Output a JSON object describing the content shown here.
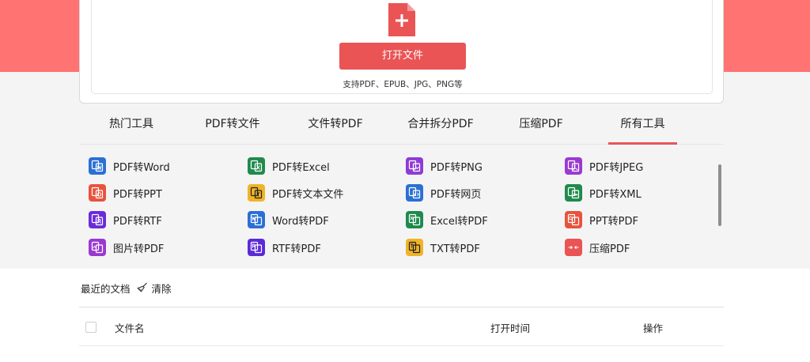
{
  "upload": {
    "button_label": "打开文件",
    "support_text": "支持PDF、EPUB、JPG、PNG等"
  },
  "tabs": [
    {
      "label": "热门工具",
      "active": false
    },
    {
      "label": "PDF转文件",
      "active": false
    },
    {
      "label": "文件转PDF",
      "active": false
    },
    {
      "label": "合并拆分PDF",
      "active": false
    },
    {
      "label": "压缩PDF",
      "active": false
    },
    {
      "label": "所有工具",
      "active": true
    }
  ],
  "tools": [
    {
      "label": "PDF转Word",
      "icon": "word-doc-icon",
      "color": "#2b6fd6"
    },
    {
      "label": "PDF转Excel",
      "icon": "excel-doc-icon",
      "color": "#1f8a4c"
    },
    {
      "label": "PDF转PNG",
      "icon": "png-image-icon",
      "color": "#8e3bd6"
    },
    {
      "label": "PDF转JPEG",
      "icon": "jpeg-image-icon",
      "color": "#9a3ad1"
    },
    {
      "label": "PDF转PPT",
      "icon": "ppt-doc-icon",
      "color": "#e8533c"
    },
    {
      "label": "PDF转文本文件",
      "icon": "text-file-icon",
      "color": "#f0b429"
    },
    {
      "label": "PDF转网页",
      "icon": "web-page-icon",
      "color": "#2b6fd6"
    },
    {
      "label": "PDF转XML",
      "icon": "xml-file-icon",
      "color": "#1f8a4c"
    },
    {
      "label": "PDF转RTF",
      "icon": "rtf-file-icon",
      "color": "#6a2bd9"
    },
    {
      "label": "Word转PDF",
      "icon": "word-to-pdf-icon",
      "color": "#2b6fd6"
    },
    {
      "label": "Excel转PDF",
      "icon": "excel-to-pdf-icon",
      "color": "#1f8a4c"
    },
    {
      "label": "PPT转PDF",
      "icon": "ppt-to-pdf-icon",
      "color": "#e8533c"
    },
    {
      "label": "图片转PDF",
      "icon": "image-to-pdf-icon",
      "color": "#9a3ad1"
    },
    {
      "label": "RTF转PDF",
      "icon": "rtf-to-pdf-icon",
      "color": "#5b2bd9"
    },
    {
      "label": "TXT转PDF",
      "icon": "txt-to-pdf-icon",
      "color": "#f0b429"
    },
    {
      "label": "压缩PDF",
      "icon": "compress-pdf-icon",
      "color": "#ea5455"
    }
  ],
  "recent": {
    "title": "最近的文档",
    "clear_label": "清除"
  },
  "table": {
    "col_filename": "文件名",
    "col_open_time": "打开时间",
    "col_actions": "操作"
  },
  "colors": {
    "brand_red": "#ea5455",
    "hero_red": "#ff7372"
  }
}
